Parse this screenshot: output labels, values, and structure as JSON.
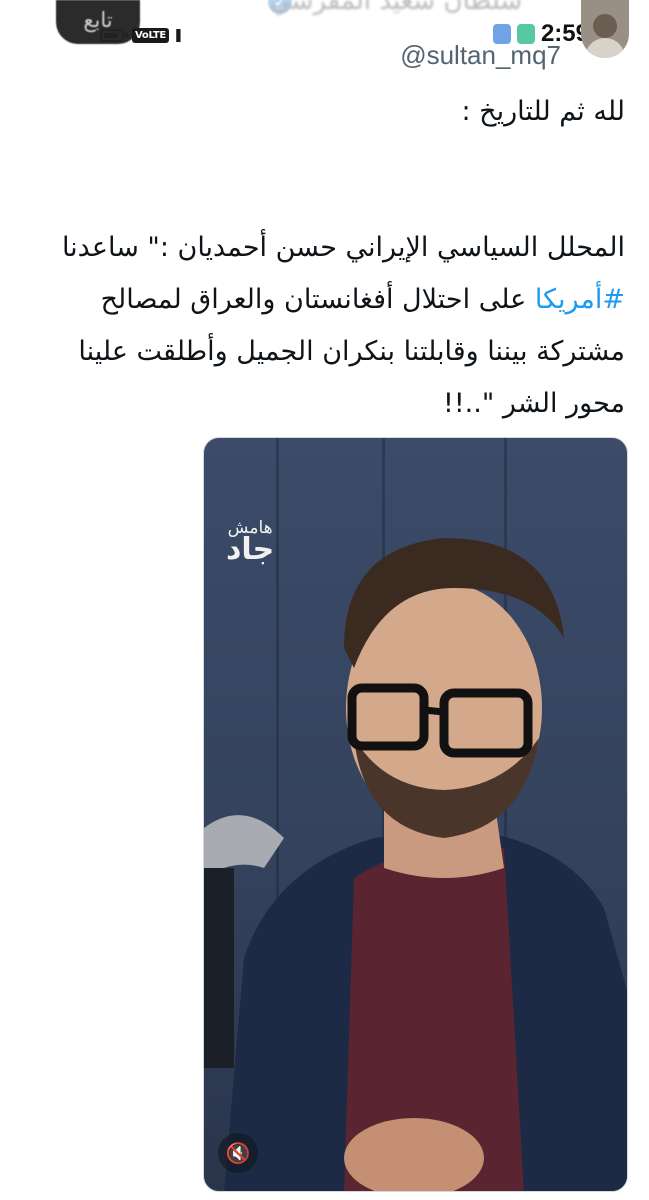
{
  "header": {
    "follow_label": "تابع",
    "author_name": "سلطان سعيد المقرشي",
    "handle": "@sultan_mq7"
  },
  "status_bar": {
    "time": "2:59",
    "network_badge": "VoLTE"
  },
  "tweet": {
    "line_intro": "لله ثم للتاريخ :",
    "line_body_1": "المحلل السياسي الإيراني حسن أحمديان :\" ساعدنا",
    "hashtag": "#أمريكا",
    "line_body_2_rest": " على احتلال أفغانستان والعراق لمصالح",
    "line_body_3": "مشتركة بيننا وقابلتنا بنكران الجميل وأطلقت علينا",
    "line_body_4": "محور الشر \"..!!"
  },
  "video": {
    "logo_line1": "هامش",
    "logo_line2": "جاد",
    "mute_icon": "speaker-muted-icon"
  },
  "colors": {
    "link": "#1d9bf0",
    "text": "#0f1419",
    "handle": "#536471",
    "video_bg": "#3b4b68"
  }
}
